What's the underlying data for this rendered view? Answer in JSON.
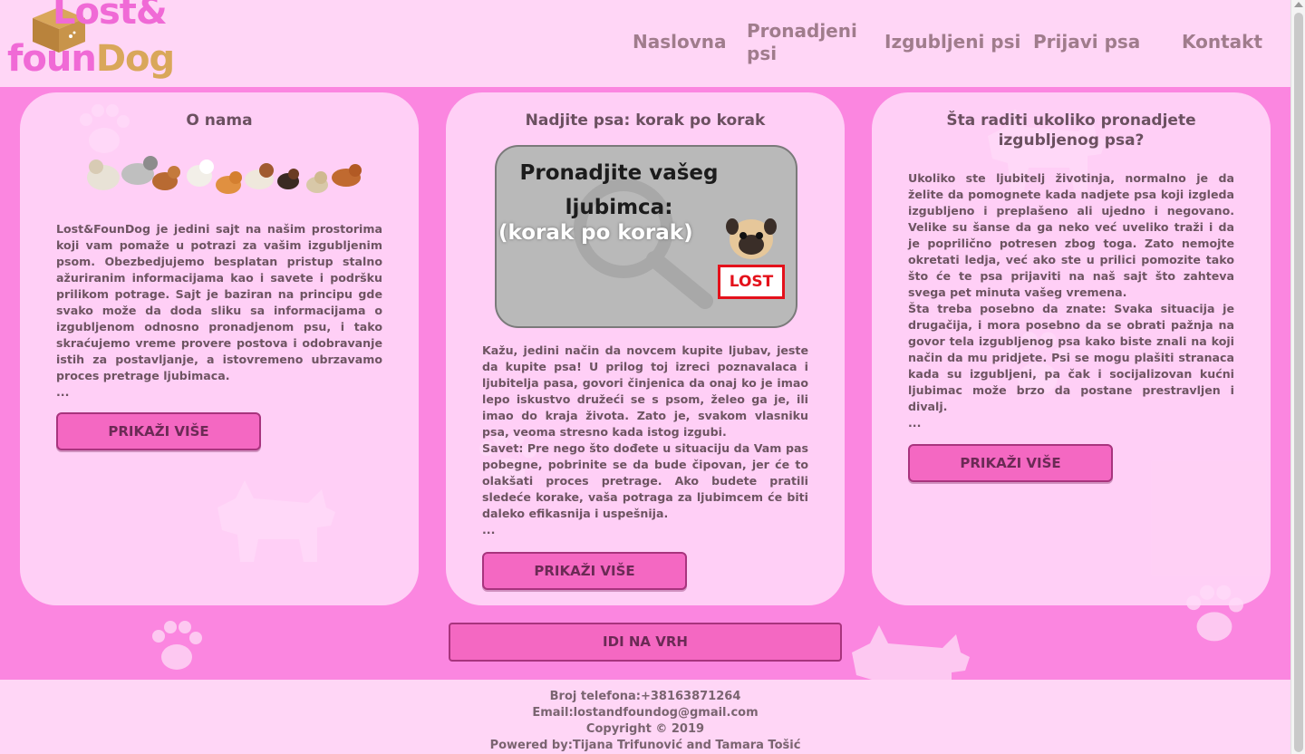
{
  "brand": {
    "logo_line1": "Lost&",
    "logo_line2_a": "foun",
    "logo_line2_b": "Dog"
  },
  "nav": {
    "items": [
      "Naslovna",
      "Pronadjeni psi",
      "Izgubljeni psi",
      "Prijavi psa",
      "Kontakt"
    ]
  },
  "cards": {
    "about": {
      "title": "O nama",
      "text": "Lost&FounDog je jedini sajt na našim prostorima koji vam pomaže u potrazi za vašim izgubljenim psom. Obezbedjujemo besplatan pristup stalno ažuriranim informacijama kao i savete i podršku prilikom potrage. Sajt je baziran na principu gde svako može da doda sliku sa informacijama o izgubljenom odnosno pronadjenom psu, i tako skraćujemo vreme provere postova i odobravanje istih za postavljanje, a istovremeno ubrzavamo proces pretrage ljubimaca.",
      "ellipsis": "...",
      "button": "PRIKAŽI VIŠE"
    },
    "steps": {
      "title": "Nadjite psa: korak po korak",
      "image_line1": "Pronadjite vašeg ljubimca:",
      "image_line2": "(korak po korak)",
      "image_badge": "LOST",
      "text": "Kažu, jedini način da novcem kupite ljubav, jeste da kupite psa! U prilog toj izreci poznavalaca i ljubitelja pasa, govori činjenica da onaj ko je imao lepo iskustvo družeći se s psom, želeo ga je, ili imao do kraja života. Zato je, svakom vlasniku psa, veoma stresno kada istog izgubi.",
      "tip": "Savet: Pre nego što dođete u situaciju da Vam pas pobegne, pobrinite se da bude čipovan, jer će to olakšati proces pretrage. Ako budete pratili sledeće korake, vaša potraga za ljubimcem će biti daleko efikasnija i uspešnija.",
      "ellipsis": "...",
      "button": "PRIKAŽI VIŠE"
    },
    "found": {
      "title": "Šta raditi ukoliko pronadjete izgubljenog psa?",
      "text": "Ukoliko ste ljubitelj životinja, normalno je da želite da pomognete kada nadjete psa koji izgleda izgubljeno i preplašeno ali ujedno i negovano. Velike su šanse da ga neko već uveliko traži i da je poprilično potresen zbog toga. Zato nemojte okretati ledja, već ako ste u prilici pomozite tako što će te psa prijaviti na naš sajt što zahteva svega pet minuta vašeg vremena.",
      "tip": "Šta treba posebno da znate: Svaka situacija je drugačija, i mora posebno da se obrati pažnja na govor tela izgubljenog psa kako biste znali na koji način da mu pridjete. Psi se mogu plašiti stranaca kada su izgubljeni, pa čak i socijalizovan kućni ljubimac može brzo da postane prestravljen i divalj.",
      "ellipsis": "...",
      "button": "PRIKAŽI VIŠE"
    }
  },
  "back_to_top": "IDI NA VRH",
  "footer": {
    "phone": "Broj telefona:+38163871264",
    "email": "Email:lostandfoundog@gmail.com",
    "copyright": "Copyright © 2019",
    "powered": "Powered by:Tijana Trifunović and Tamara Tošić"
  },
  "colors": {
    "page_bg": "#fb86e0",
    "header_bg": "#ffd6f6",
    "button": "#f468c2",
    "brand_pink": "#f06ad6",
    "brand_gold": "#d9a75a",
    "lost_red": "#e4111b"
  }
}
